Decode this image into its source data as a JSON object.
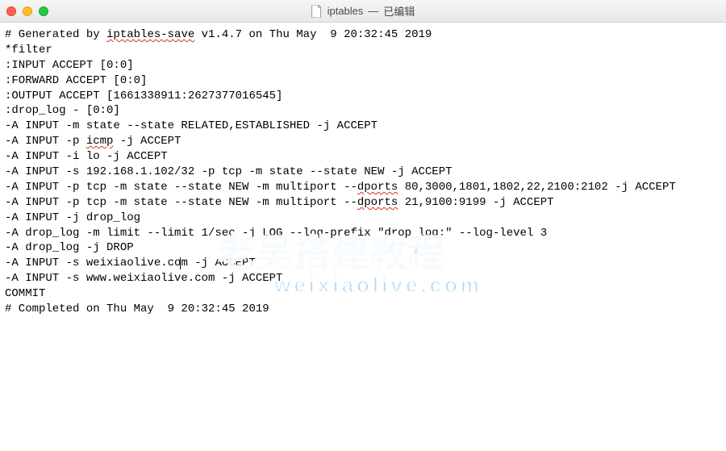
{
  "titlebar": {
    "filename": "iptables",
    "separator": " — ",
    "status": "已编辑"
  },
  "content": {
    "lines": [
      {
        "text": "# Generated by iptables-save v1.4.7 on Thu May  9 20:32:45 2019",
        "spell_ranges": [
          [
            15,
            28
          ]
        ]
      },
      {
        "text": "*filter"
      },
      {
        "text": ":INPUT ACCEPT [0:0]"
      },
      {
        "text": ":FORWARD ACCEPT [0:0]"
      },
      {
        "text": ":OUTPUT ACCEPT [1661338911:2627377016545]"
      },
      {
        "text": ":drop_log - [0:0]"
      },
      {
        "text": "-A INPUT -m state --state RELATED,ESTABLISHED -j ACCEPT"
      },
      {
        "text": "-A INPUT -p icmp -j ACCEPT",
        "spell_ranges": [
          [
            12,
            16
          ]
        ]
      },
      {
        "text": "-A INPUT -i lo -j ACCEPT"
      },
      {
        "text": "-A INPUT -s 192.168.1.102/32 -p tcp -m state --state NEW -j ACCEPT"
      },
      {
        "text": "-A INPUT -p tcp -m state --state NEW -m multiport --dports 80,3000,1801,1802,22,2100:2102 -j ACCEPT",
        "spell_ranges": [
          [
            52,
            58
          ]
        ]
      },
      {
        "text": "-A INPUT -p tcp -m state --state NEW -m multiport --dports 21,9100:9199 -j ACCEPT",
        "spell_ranges": [
          [
            52,
            58
          ]
        ]
      },
      {
        "text": "-A INPUT -j drop_log"
      },
      {
        "text": "-A drop_log -m limit --limit 1/sec -j LOG --log-prefix \"drop_log:\" --log-level 3"
      },
      {
        "text": "-A drop_log -j DROP"
      },
      {
        "text": "-A INPUT -s weixiaolive.com -j ACCEPT",
        "cursor_after": 26
      },
      {
        "text": "-A INPUT -s www.weixiaolive.com -j ACCEPT"
      },
      {
        "text": "COMMIT"
      },
      {
        "text": "# Completed on Thu May  9 20:32:45 2019"
      }
    ]
  },
  "watermark": {
    "line1": "老吴搭建教程",
    "line2": "weixiaolive.com"
  }
}
